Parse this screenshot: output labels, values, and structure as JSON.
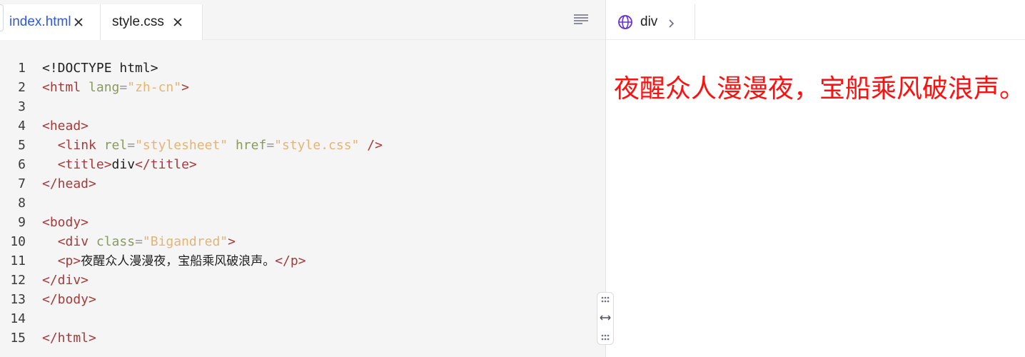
{
  "tabs": [
    {
      "label": "index.html",
      "active": true
    },
    {
      "label": "style.css",
      "active": false
    }
  ],
  "code_lines": [
    {
      "num": "1",
      "segments": [
        {
          "t": "<!DOCTYPE html>",
          "c": "text"
        }
      ]
    },
    {
      "num": "2",
      "segments": [
        {
          "t": "<html ",
          "c": "tag"
        },
        {
          "t": "lang",
          "c": "attr"
        },
        {
          "t": "=",
          "c": "punc"
        },
        {
          "t": "\"zh-cn\"",
          "c": "str"
        },
        {
          "t": ">",
          "c": "tag"
        }
      ]
    },
    {
      "num": "3",
      "segments": []
    },
    {
      "num": "4",
      "segments": [
        {
          "t": "<head>",
          "c": "tag"
        }
      ]
    },
    {
      "num": "5",
      "segments": [
        {
          "t": "  ",
          "c": "text"
        },
        {
          "t": "<link ",
          "c": "tag"
        },
        {
          "t": "rel",
          "c": "attr"
        },
        {
          "t": "=",
          "c": "punc"
        },
        {
          "t": "\"stylesheet\"",
          "c": "str"
        },
        {
          "t": " ",
          "c": "text"
        },
        {
          "t": "href",
          "c": "attr"
        },
        {
          "t": "=",
          "c": "punc"
        },
        {
          "t": "\"style.css\"",
          "c": "str"
        },
        {
          "t": " />",
          "c": "tag"
        }
      ]
    },
    {
      "num": "6",
      "segments": [
        {
          "t": "  ",
          "c": "text"
        },
        {
          "t": "<title>",
          "c": "tag"
        },
        {
          "t": "div",
          "c": "text"
        },
        {
          "t": "</title>",
          "c": "tag"
        }
      ]
    },
    {
      "num": "7",
      "segments": [
        {
          "t": "</head>",
          "c": "tag"
        }
      ]
    },
    {
      "num": "8",
      "segments": []
    },
    {
      "num": "9",
      "segments": [
        {
          "t": "<body>",
          "c": "tag"
        }
      ]
    },
    {
      "num": "10",
      "segments": [
        {
          "t": "  ",
          "c": "text"
        },
        {
          "t": "<div ",
          "c": "tag"
        },
        {
          "t": "class",
          "c": "attr"
        },
        {
          "t": "=",
          "c": "punc"
        },
        {
          "t": "\"Bigandred\"",
          "c": "str"
        },
        {
          "t": ">",
          "c": "tag"
        }
      ]
    },
    {
      "num": "11",
      "segments": [
        {
          "t": "  ",
          "c": "text"
        },
        {
          "t": "<p>",
          "c": "tag"
        },
        {
          "t": "夜醒众人漫漫夜，宝船乘风破浪声。",
          "c": "cjk"
        },
        {
          "t": "</p>",
          "c": "tag"
        }
      ]
    },
    {
      "num": "12",
      "segments": [
        {
          "t": "</div>",
          "c": "tag"
        }
      ]
    },
    {
      "num": "13",
      "segments": [
        {
          "t": "</body>",
          "c": "tag"
        }
      ]
    },
    {
      "num": "14",
      "segments": []
    },
    {
      "num": "15",
      "segments": [
        {
          "t": "</html>",
          "c": "tag"
        }
      ]
    }
  ],
  "preview": {
    "tab_label": "div",
    "text": "夜醒众人漫漫夜，宝船乘风破浪声。",
    "text_color": "#ff1010"
  },
  "icons": {
    "close": "close-icon",
    "menu": "menu-lines-icon",
    "globe": "globe-icon",
    "chevron": "chevron-right-icon",
    "drag": "drag-dots-icon",
    "resize": "horizontal-resize-icon"
  },
  "colors": {
    "tag": "#a53a3a",
    "attr": "#8a9a5b",
    "string": "#e5b473",
    "active_tab_text": "#2f5ad8",
    "globe": "#6a2fd8"
  }
}
